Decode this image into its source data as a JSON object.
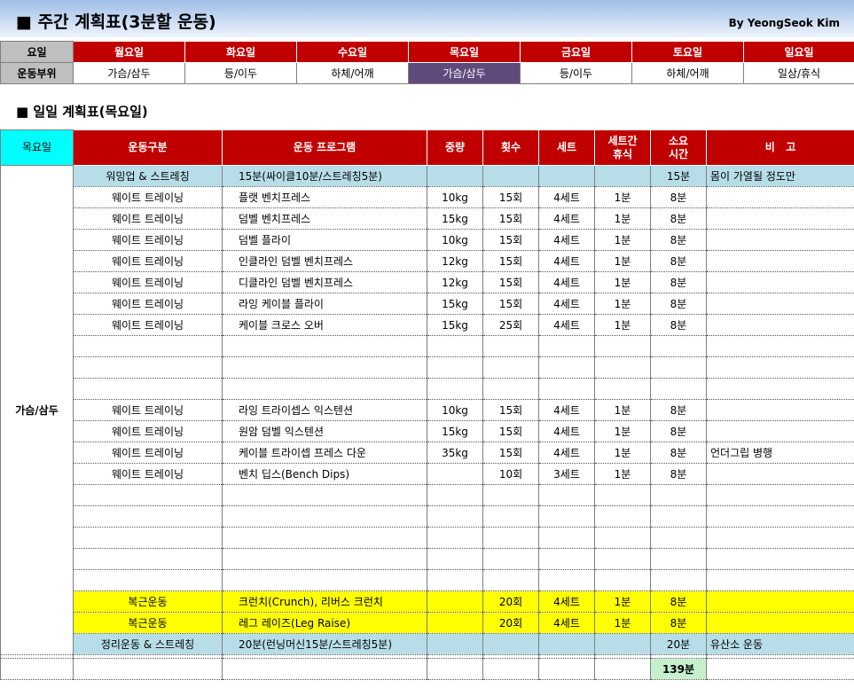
{
  "header": {
    "title": "■ 주간 계획표(3분할 운동)",
    "author": "By YeongSeok Kim"
  },
  "weekly": {
    "row_labels": [
      "요일",
      "운동부위"
    ],
    "days": [
      "월요일",
      "화요일",
      "수요일",
      "목요일",
      "금요일",
      "토요일",
      "일요일"
    ],
    "parts": [
      "가슴/삼두",
      "등/이두",
      "하체/어깨",
      "가슴/삼두",
      "등/이두",
      "하체/어깨",
      "일상/휴식"
    ],
    "selected_index": 3
  },
  "daily": {
    "title": "■ 일일 계획표(목요일)",
    "headers": [
      "목요일",
      "운동구분",
      "운동 프로그램",
      "중량",
      "횟수",
      "세트",
      "세트간\n휴식",
      "소요\n시간",
      "비   고"
    ],
    "day_part": "가슴/삼두",
    "rows": [
      [
        "워밍업 & 스트레칭",
        "15분(싸이클10분/스트레칭5분)",
        "",
        "",
        "",
        "",
        "15분",
        "몸이 가열될 정도만"
      ],
      [
        "웨이트 트레이닝",
        "플랫 벤치프레스",
        "10kg",
        "15회",
        "4세트",
        "1분",
        "8분",
        ""
      ],
      [
        "웨이트 트레이닝",
        "덤벨 벤치프레스",
        "15kg",
        "15회",
        "4세트",
        "1분",
        "8분",
        ""
      ],
      [
        "웨이트 트레이닝",
        "덤벨 플라이",
        "10kg",
        "15회",
        "4세트",
        "1분",
        "8분",
        ""
      ],
      [
        "웨이트 트레이닝",
        "인클라인 덤벨 벤치프레스",
        "12kg",
        "15회",
        "4세트",
        "1분",
        "8분",
        ""
      ],
      [
        "웨이트 트레이닝",
        "디클라인 덤벨 벤치프레스",
        "12kg",
        "15회",
        "4세트",
        "1분",
        "8분",
        ""
      ],
      [
        "웨이트 트레이닝",
        "라잉 케이블 플라이",
        "15kg",
        "15회",
        "4세트",
        "1분",
        "8분",
        ""
      ],
      [
        "웨이트 트레이닝",
        "케이블 크로스 오버",
        "15kg",
        "25회",
        "4세트",
        "1분",
        "8분",
        ""
      ],
      [
        "",
        "",
        "",
        "",
        "",
        "",
        "",
        ""
      ],
      [
        "",
        "",
        "",
        "",
        "",
        "",
        "",
        ""
      ],
      [
        "",
        "",
        "",
        "",
        "",
        "",
        "",
        ""
      ],
      [
        "웨이트 트레이닝",
        "라잉 트라이셉스 익스텐션",
        "10kg",
        "15회",
        "4세트",
        "1분",
        "8분",
        ""
      ],
      [
        "웨이트 트레이닝",
        "원암 덤벨 익스텐션",
        "15kg",
        "15회",
        "4세트",
        "1분",
        "8분",
        ""
      ],
      [
        "웨이트 트레이닝",
        "케이블 트라이셉 프레스 다운",
        "35kg",
        "15회",
        "4세트",
        "1분",
        "8분",
        "언더그립 병행"
      ],
      [
        "웨이트 트레이닝",
        "벤치 딥스(Bench Dips)",
        "",
        "10회",
        "3세트",
        "1분",
        "8분",
        ""
      ],
      [
        "",
        "",
        "",
        "",
        "",
        "",
        "",
        ""
      ],
      [
        "",
        "",
        "",
        "",
        "",
        "",
        "",
        ""
      ],
      [
        "",
        "",
        "",
        "",
        "",
        "",
        "",
        ""
      ],
      [
        "",
        "",
        "",
        "",
        "",
        "",
        "",
        ""
      ],
      [
        "",
        "",
        "",
        "",
        "",
        "",
        "",
        ""
      ],
      [
        "복근운동",
        "크런치(Crunch), 리버스 크런치",
        "",
        "20회",
        "4세트",
        "1분",
        "8분",
        ""
      ],
      [
        "복근운동",
        "레그 레이즈(Leg Raise)",
        "",
        "20회",
        "4세트",
        "1분",
        "8분",
        ""
      ],
      [
        "정리운동 & 스트레칭",
        "20분(런닝머신15분/스트레칭5분)",
        "",
        "",
        "",
        "",
        "20분",
        "유산소 운동"
      ]
    ],
    "row_styles": [
      "blue",
      "",
      "",
      "",
      "",
      "",
      "",
      "",
      "",
      "",
      "",
      "",
      "",
      "",
      "",
      "",
      "",
      "",
      "",
      "",
      "yellow",
      "yellow",
      "blue"
    ],
    "total": "139분"
  },
  "colors": {
    "header_red": "#c00000",
    "day_cyan": "#00ffff",
    "selected_purple": "#604a7b",
    "light_blue": "#b7dee8",
    "yellow": "#ffff00",
    "total_green": "#c6efce"
  }
}
